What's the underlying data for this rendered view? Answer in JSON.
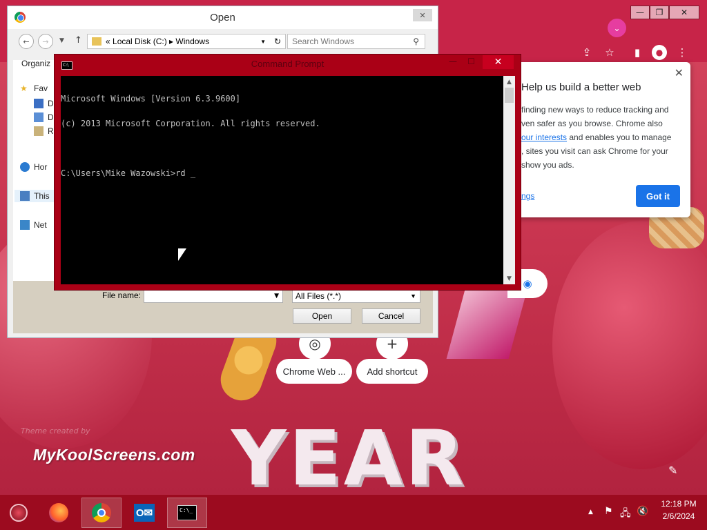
{
  "open_dialog": {
    "title": "Open",
    "address": {
      "prefix": "«",
      "segments": [
        "Local Disk (C:)",
        "Windows"
      ]
    },
    "search_placeholder": "Search Windows",
    "organize_label": "Organiz",
    "nav_items": [
      "Fav",
      "D",
      "D",
      "R",
      "Hor",
      "This",
      "Net"
    ],
    "file_name_label": "File name:",
    "file_name_value": "",
    "filter_value": "All Files (*.*)",
    "open_label": "Open",
    "cancel_label": "Cancel"
  },
  "cmd": {
    "title": "Command Prompt",
    "lines": [
      "Microsoft Windows [Version 6.3.9600]",
      "(c) 2013 Microsoft Corporation. All rights reserved.",
      "",
      "C:\\Users\\Mike Wazowski>rd _"
    ]
  },
  "chrome": {
    "help_popup": {
      "title": "Help us build a better web",
      "body_1": "finding new ways to reduce tracking and",
      "body_2": "ven safer as you browse. Chrome also",
      "body_3_link": "our interests",
      "body_3_rest": " and enables you to manage",
      "body_4": ", sites you visit can ask Chrome for your",
      "body_5": " show you ads.",
      "settings_link": "ngs",
      "got_it_label": "Got it"
    },
    "shortcuts": [
      "Chrome Web ...",
      "Add shortcut"
    ],
    "theme_credit": "Theme created by",
    "brand_text": "MyKoolScreens.com",
    "art_text": "YEAR"
  },
  "taskbar": {
    "clock_time": "12:18 PM",
    "clock_date": "2/6/2024"
  },
  "colors": {
    "cmd_frame": "#aa0016",
    "taskbar": "#9c0b1f",
    "chrome_toolbar": "#c72448",
    "accent_blue": "#1a73e8"
  }
}
